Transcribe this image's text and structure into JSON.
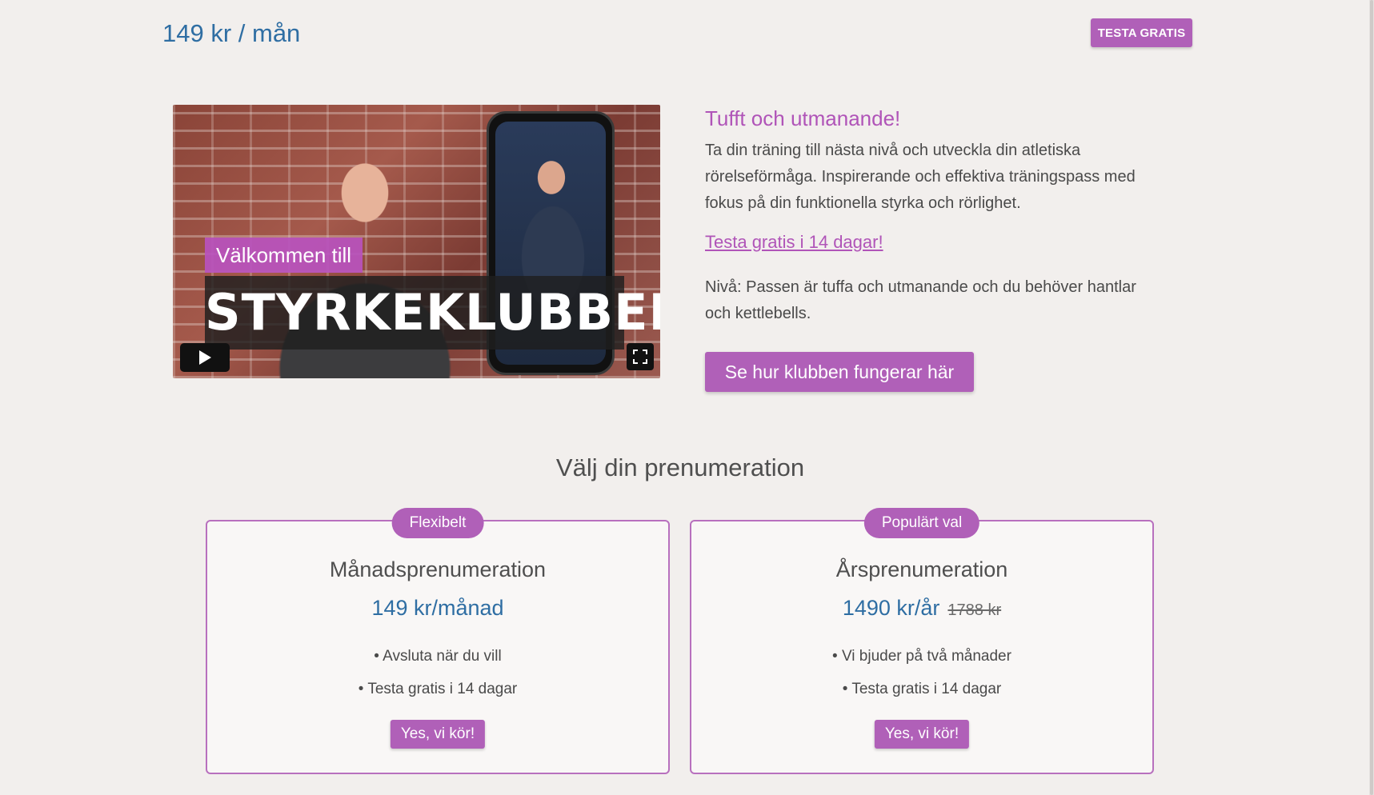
{
  "header": {
    "price_label": "149 kr / mån",
    "cta_label": "TESTA GRATIS"
  },
  "video": {
    "welcome_text": "Välkommen till",
    "brand_text": "STYRKEKLUBBEN",
    "play_icon": "play-icon",
    "fullscreen_icon": "fullscreen-icon"
  },
  "description": {
    "title": "Tufft och utmanande!",
    "text": "Ta din träning till nästa nivå och utveckla din atletiska rörelseförmåga. Inspirerande och effektiva träningspass med fokus på din funktionella styrka och rörlighet.",
    "trial_link": "Testa gratis i 14 dagar!",
    "level_text": "Nivå: Passen är tuffa och utmanande och du behöver hantlar och kettlebells.",
    "how_button": "Se hur klubben fungerar här"
  },
  "subscriptions": {
    "section_title": "Välj din prenumeration",
    "plans": [
      {
        "badge": "Flexibelt",
        "name": "Månadsprenumeration",
        "price": "149 kr/månad",
        "old_price": "",
        "features": [
          "• Avsluta när du vill",
          "• Testa gratis i 14 dagar"
        ],
        "cta": "Yes, vi kör!"
      },
      {
        "badge": "Populärt val",
        "name": "Årsprenumeration",
        "price": "1490 kr/år",
        "old_price": "1788 kr",
        "features": [
          "• Vi bjuder på två månader",
          "• Testa gratis i 14 dagar"
        ],
        "cta": "Yes, vi kör!"
      }
    ]
  },
  "colors": {
    "accent": "#b060b8",
    "price_blue": "#2f6ea3",
    "background": "#f2efed"
  }
}
